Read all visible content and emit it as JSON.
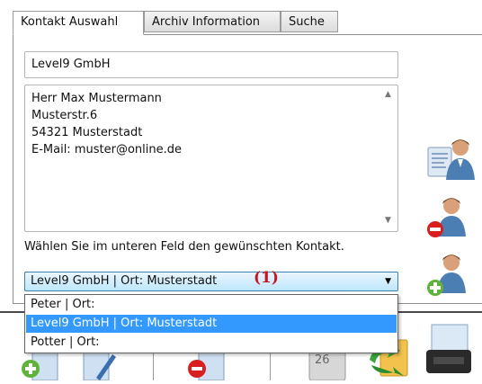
{
  "tabs": [
    {
      "label": "Kontakt Auswahl",
      "active": true
    },
    {
      "label": "Archiv Information",
      "active": false
    },
    {
      "label": "Suche",
      "active": false
    }
  ],
  "company_field": {
    "value": "Level9 GmbH"
  },
  "address_box": {
    "lines": [
      "Herr Max Mustermann",
      "Musterstr.6",
      "54321  Musterstadt",
      "E-Mail: muster@online.de"
    ]
  },
  "hint_text": "Wählen Sie im unteren Feld den gewünschten Kontakt.",
  "contact_combo": {
    "selected": "Level9 GmbH | Ort: Musterstadt",
    "options": [
      "Peter | Ort:",
      "Level9 GmbH | Ort: Musterstadt",
      "Potter | Ort:"
    ],
    "highlighted_index": 1
  },
  "annotation_marker": "(1)",
  "side_icons": [
    "contact-card-icon",
    "remove-contact-icon",
    "add-contact-icon"
  ],
  "toolbar_icons": [
    "add-document-icon",
    "edit-document-icon",
    "remove-document-icon",
    "calendar-icon",
    "refresh-icon",
    "print-icon"
  ],
  "toolbar_calendar_text": "26",
  "colors": {
    "selection": "#3399ff",
    "combo_border": "#3c7fb1",
    "marker": "#c8141e"
  }
}
